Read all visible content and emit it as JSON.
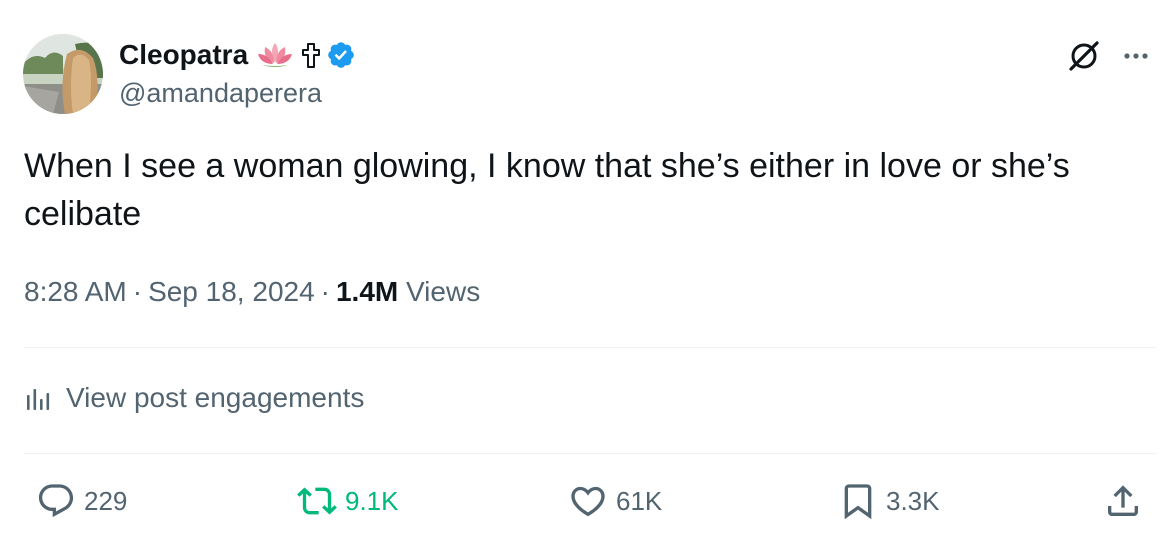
{
  "author": {
    "display_name": "Cleopatra",
    "handle": "@amandaperera",
    "emoji_lotus": "lotus-emoji",
    "emoji_cross": "latin-cross-emoji",
    "verified_badge": "verified-icon"
  },
  "post": {
    "text": "When I see a woman glowing, I know that she’s either in love or she’s celibate",
    "time": "8:28 AM",
    "separator": "·",
    "date": "Sep 18, 2024",
    "views_count": "1.4M",
    "views_label": "Views"
  },
  "engagements": {
    "label": "View post engagements",
    "icon": "bar-chart-icon"
  },
  "actions": {
    "reply": {
      "icon": "reply-icon",
      "count": "229"
    },
    "retweet": {
      "icon": "retweet-icon",
      "count": "9.1K",
      "color": "#00ba7c"
    },
    "like": {
      "icon": "heart-icon",
      "count": "61K"
    },
    "bookmark": {
      "icon": "bookmark-icon",
      "count": "3.3K"
    },
    "share": {
      "icon": "share-icon"
    }
  },
  "header_icons": {
    "grok": "grok-icon",
    "more": "more-icon"
  },
  "colors": {
    "text_primary": "#0f1419",
    "text_secondary": "#536471",
    "verified_blue": "#1d9bf0",
    "retweet_green": "#00ba7c",
    "divider": "#eff3f4"
  }
}
